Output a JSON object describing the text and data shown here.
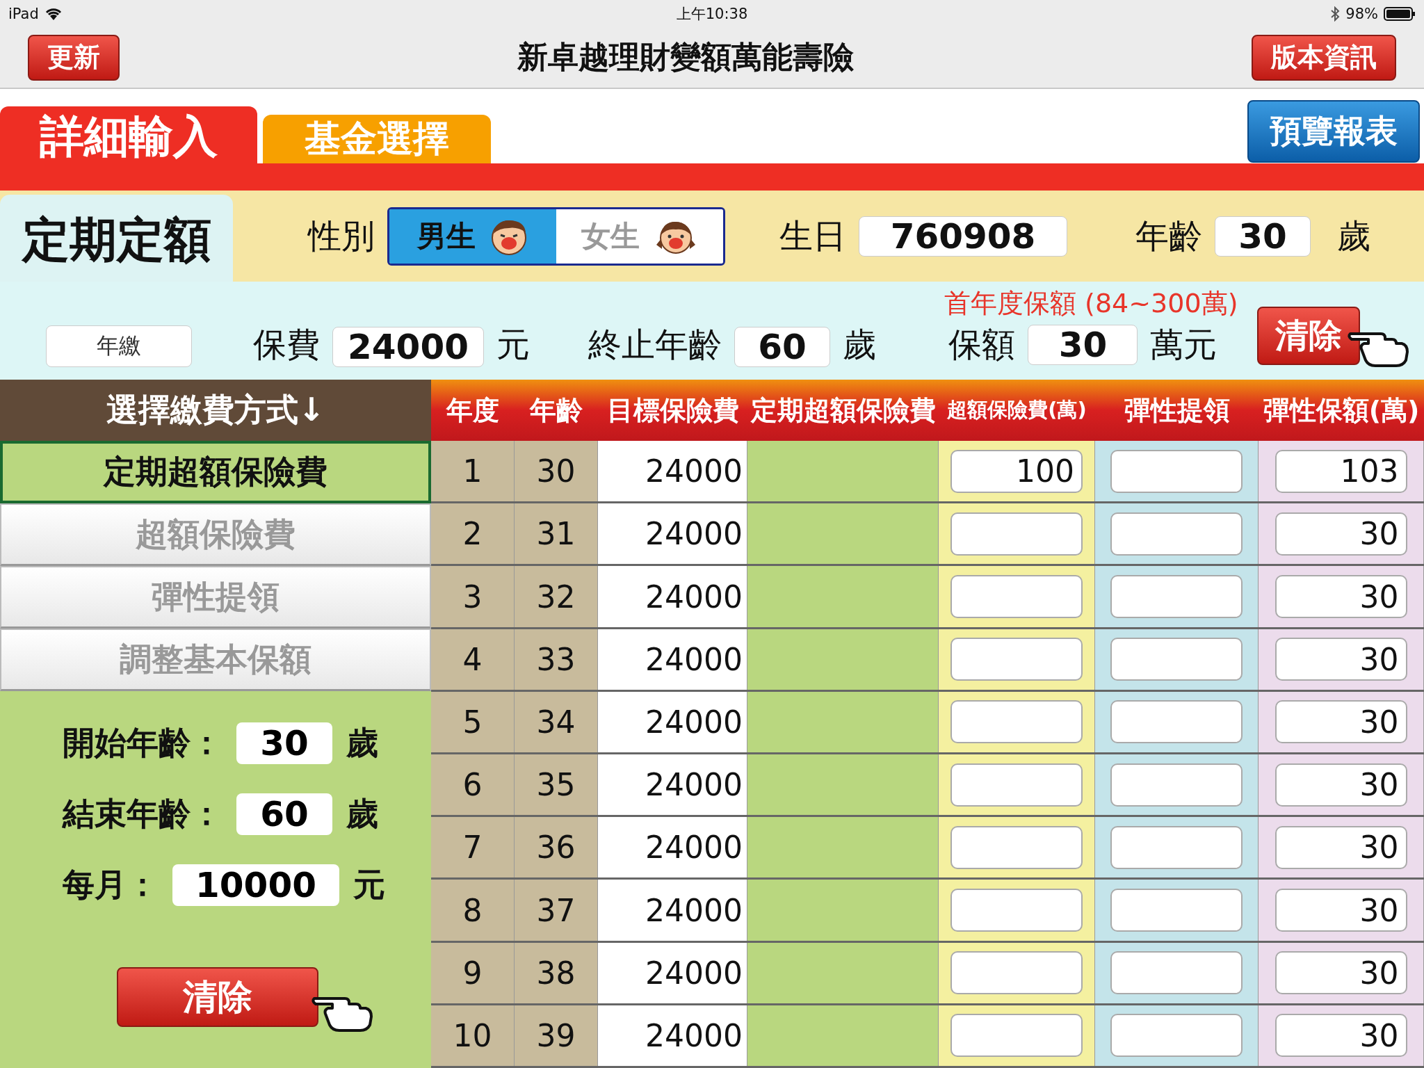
{
  "status_bar": {
    "carrier": "iPad",
    "time": "上午10:38",
    "battery": "98%"
  },
  "nav": {
    "left_button": "更新",
    "title": "新卓越理財變額萬能壽險",
    "right_button": "版本資訊"
  },
  "tabs": [
    {
      "label": "詳細輸入",
      "selected": true
    },
    {
      "label": "基金選擇",
      "selected": false
    }
  ],
  "preview_button": "預覽報表",
  "plan_title": "定期定額",
  "gender": {
    "label": "性別",
    "options": [
      {
        "label": "男生",
        "selected": true,
        "kind": "boy"
      },
      {
        "label": "女生",
        "selected": false,
        "kind": "girl"
      }
    ]
  },
  "birthday": {
    "label": "生日",
    "value": "760908"
  },
  "age": {
    "label": "年齡",
    "value": "30",
    "unit": "歲"
  },
  "payment_mode": "年繳",
  "premium": {
    "label": "保費",
    "value": "24000",
    "unit": "元"
  },
  "end_age": {
    "label": "終止年齡",
    "value": "60",
    "unit": "歲"
  },
  "coverage_hint": "首年度保額 (84~300萬)",
  "coverage": {
    "label": "保額",
    "value": "30",
    "unit": "萬元"
  },
  "clear_button": "清除",
  "left_panel": {
    "header": "選擇繳費方式↓",
    "modes": [
      {
        "label": "定期超額保險費",
        "selected": true
      },
      {
        "label": "超額保險費",
        "selected": false
      },
      {
        "label": "彈性提領",
        "selected": false
      },
      {
        "label": "調整基本保額",
        "selected": false
      }
    ],
    "fields": [
      {
        "label": "開始年齡：",
        "value": "30",
        "unit": "歲"
      },
      {
        "label": "結束年齡：",
        "value": "60",
        "unit": "歲"
      },
      {
        "label": "每月：",
        "value": "10000",
        "unit": "元"
      }
    ],
    "clear_button": "清除"
  },
  "table": {
    "columns": [
      "年度",
      "年齡",
      "目標保險費",
      "定期超額保險費",
      "超額保險費(萬)",
      "彈性提領",
      "彈性保額(萬)"
    ],
    "rows": [
      {
        "year": "1",
        "age": "30",
        "target": "24000",
        "excess": "100",
        "flex_coverage": "103"
      },
      {
        "year": "2",
        "age": "31",
        "target": "24000",
        "flex_coverage": "30"
      },
      {
        "year": "3",
        "age": "32",
        "target": "24000",
        "flex_coverage": "30"
      },
      {
        "year": "4",
        "age": "33",
        "target": "24000",
        "flex_coverage": "30"
      },
      {
        "year": "5",
        "age": "34",
        "target": "24000",
        "flex_coverage": "30"
      },
      {
        "year": "6",
        "age": "35",
        "target": "24000",
        "flex_coverage": "30"
      },
      {
        "year": "7",
        "age": "36",
        "target": "24000",
        "flex_coverage": "30"
      },
      {
        "year": "8",
        "age": "37",
        "target": "24000",
        "flex_coverage": "30"
      },
      {
        "year": "9",
        "age": "38",
        "target": "24000",
        "flex_coverage": "30"
      },
      {
        "year": "10",
        "age": "39",
        "target": "24000",
        "flex_coverage": "30"
      }
    ]
  }
}
